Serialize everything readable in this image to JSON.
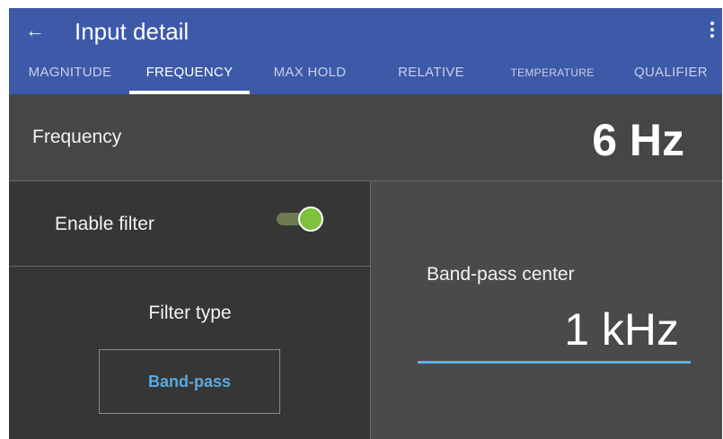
{
  "appbar": {
    "back_icon": "arrow-left-icon",
    "title": "Input detail",
    "overflow_icon": "more-vertical-icon",
    "color": "#3d5aa8"
  },
  "tabs": [
    {
      "label": "MAGNITUDE",
      "active": false
    },
    {
      "label": "FREQUENCY",
      "active": true
    },
    {
      "label": "MAX HOLD",
      "active": false
    },
    {
      "label": "RELATIVE",
      "active": false
    },
    {
      "label": "TEMPERATURE",
      "active": false
    },
    {
      "label": "QUALIFIER",
      "active": false
    }
  ],
  "frequency": {
    "label": "Frequency",
    "value": "6 Hz"
  },
  "filter": {
    "enable_label": "Enable filter",
    "enabled": true,
    "switch_color": "#7dc13f",
    "type_label": "Filter type",
    "type_value": "Band-pass",
    "type_color": "#5aa9e0"
  },
  "band_pass": {
    "label": "Band-pass center",
    "value": "1 kHz",
    "underline_color": "#5fb1e3"
  }
}
